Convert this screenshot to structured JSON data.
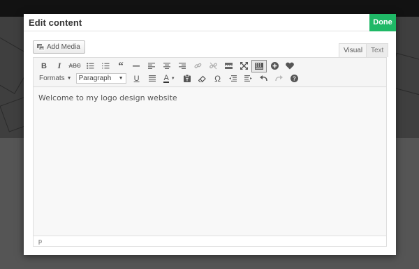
{
  "modal": {
    "title": "Edit content",
    "done_label": "Done"
  },
  "editor": {
    "add_media_label": "Add Media",
    "tabs": {
      "visual": "Visual",
      "text": "Text"
    },
    "toolbar_row1": [
      "bold-icon",
      "italic-icon",
      "strikethrough-icon",
      "bullet-list-icon",
      "numbered-list-icon",
      "blockquote-icon",
      "horizontal-rule-icon",
      "align-left-icon",
      "align-center-icon",
      "align-right-icon",
      "link-icon",
      "unlink-icon",
      "read-more-icon",
      "fullscreen-icon",
      "toolbar-toggle-icon",
      "add-icon",
      "heart-icon"
    ],
    "formats_label": "Formats",
    "paragraph_value": "Paragraph",
    "content_text": "Welcome to my logo design website",
    "status_path": "p"
  },
  "colors": {
    "done_bg": "#1fb866",
    "overlay": "#4d4d4d"
  }
}
